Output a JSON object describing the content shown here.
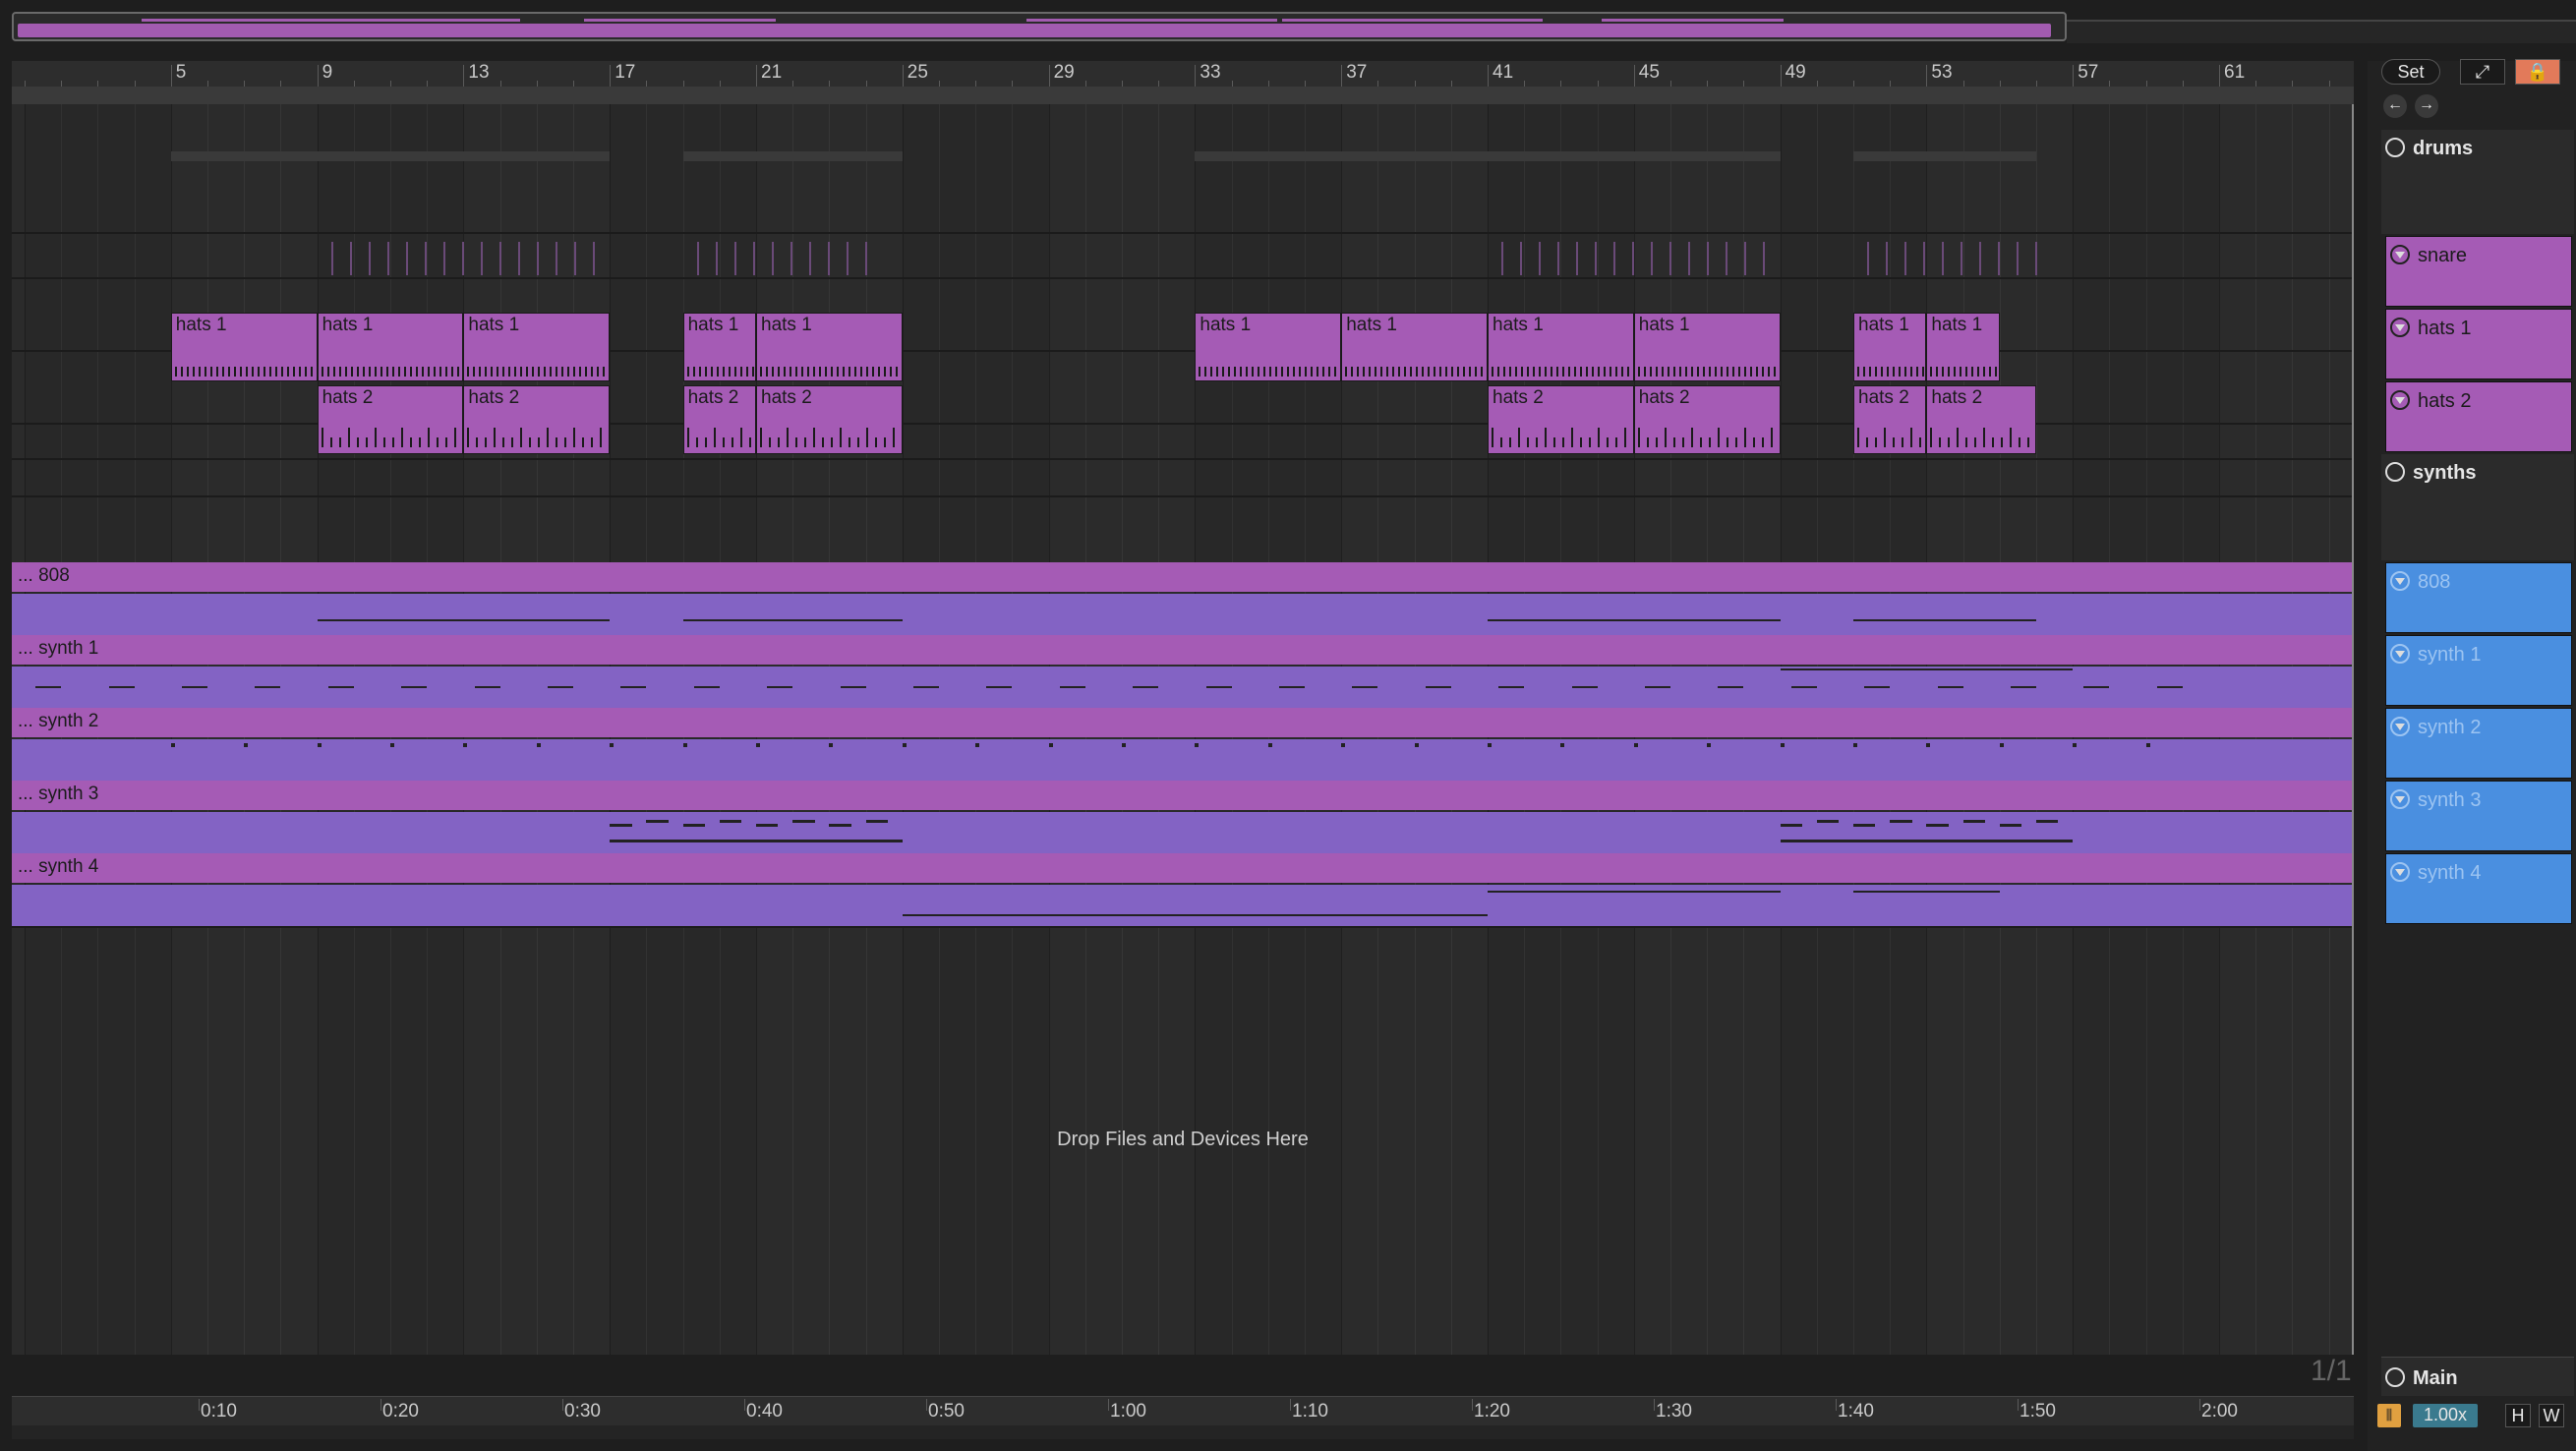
{
  "ruler": {
    "bar_numbers": [
      "5",
      "9",
      "13",
      "17",
      "21",
      "25",
      "29",
      "33",
      "37",
      "41",
      "45",
      "49",
      "53",
      "57",
      "61"
    ]
  },
  "tracks": {
    "drums": {
      "name": "drums"
    },
    "snare": {
      "name": "snare"
    },
    "hats1": {
      "name": "hats 1",
      "clip_label": "hats 1"
    },
    "hats2": {
      "name": "hats 2",
      "clip_label": "hats 2"
    },
    "synths": {
      "name": "synths"
    },
    "t808": {
      "name": "808",
      "clip_label": "... 808"
    },
    "synth1": {
      "name": "synth 1",
      "clip_label": "... synth 1"
    },
    "synth2": {
      "name": "synth 2",
      "clip_label": "... synth 2"
    },
    "synth3": {
      "name": "synth 3",
      "clip_label": "... synth 3"
    },
    "synth4": {
      "name": "synth 4",
      "clip_label": "... synth 4"
    },
    "main": {
      "name": "Main"
    }
  },
  "drop_text": "Drop Files and Devices Here",
  "page_counter": "1/1",
  "time_labels": [
    "0:10",
    "0:20",
    "0:30",
    "0:40",
    "0:50",
    "1:00",
    "1:10",
    "1:20",
    "1:30",
    "1:40",
    "1:50",
    "2:00"
  ],
  "controls": {
    "set_label": "Set",
    "zoom_value": "1.00x",
    "h_label": "H",
    "w_label": "W"
  },
  "colors": {
    "clip_drums": "#a55bb5",
    "clip_synth_body": "#8363c4",
    "header_synth": "#4a8fe0",
    "header_drum": "#a55bb5",
    "lock_button": "#e27a5a"
  }
}
